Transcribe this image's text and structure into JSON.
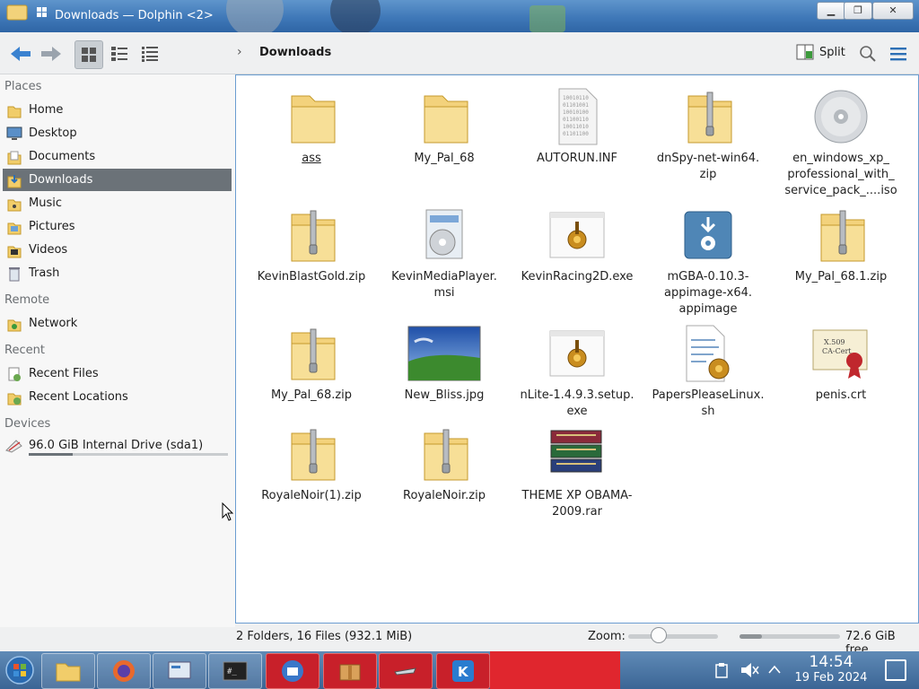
{
  "window": {
    "title": "Downloads — Dolphin <2>",
    "minimize": "▁",
    "maximize": "❐",
    "close": "✕"
  },
  "toolbar": {
    "breadcrumb": "Downloads",
    "split_label": "Split"
  },
  "sidebar": {
    "sections": {
      "places": "Places",
      "remote": "Remote",
      "recent": "Recent",
      "devices": "Devices"
    },
    "places": [
      {
        "label": "Home",
        "icon": "home-icon"
      },
      {
        "label": "Desktop",
        "icon": "desktop-icon"
      },
      {
        "label": "Documents",
        "icon": "documents-icon"
      },
      {
        "label": "Downloads",
        "icon": "downloads-icon",
        "selected": true
      },
      {
        "label": "Music",
        "icon": "music-icon"
      },
      {
        "label": "Pictures",
        "icon": "pictures-icon"
      },
      {
        "label": "Videos",
        "icon": "videos-icon"
      },
      {
        "label": "Trash",
        "icon": "trash-icon"
      }
    ],
    "remote": [
      {
        "label": "Network",
        "icon": "network-icon"
      }
    ],
    "recent": [
      {
        "label": "Recent Files",
        "icon": "recent-files-icon"
      },
      {
        "label": "Recent Locations",
        "icon": "recent-locations-icon"
      }
    ],
    "devices": [
      {
        "label": "96.0 GiB Internal Drive (sda1)",
        "icon": "drive-icon",
        "usage_fraction": 0.22
      }
    ]
  },
  "files": [
    {
      "name": "ass",
      "type": "folder"
    },
    {
      "name": "My_Pal_68",
      "type": "folder"
    },
    {
      "name": "AUTORUN.INF",
      "type": "text"
    },
    {
      "name": "dnSpy-net-win64.\nzip",
      "type": "zip"
    },
    {
      "name": "en_windows_xp_\nprofessional_with_\nservice_pack_....iso",
      "type": "disc"
    },
    {
      "name": "KevinBlastGold.zip",
      "type": "zip"
    },
    {
      "name": "KevinMediaPlayer.\nmsi",
      "type": "msi"
    },
    {
      "name": "KevinRacing2D.exe",
      "type": "exe"
    },
    {
      "name": "mGBA-0.10.3-\nappimage-x64.\nappimage",
      "type": "appimage"
    },
    {
      "name": "My_Pal_68.1.zip",
      "type": "zip"
    },
    {
      "name": "My_Pal_68.zip",
      "type": "zip"
    },
    {
      "name": "New_Bliss.jpg",
      "type": "image"
    },
    {
      "name": "nLite-1.4.9.3.setup.\nexe",
      "type": "exe"
    },
    {
      "name": "PapersPleaseLinux.\nsh",
      "type": "script"
    },
    {
      "name": "penis.crt",
      "type": "cert"
    },
    {
      "name": "RoyaleNoir(1).zip",
      "type": "zip"
    },
    {
      "name": "RoyaleNoir.zip",
      "type": "zip"
    },
    {
      "name": "THEME XP OBAMA-\n2009.rar",
      "type": "rar"
    }
  ],
  "status": {
    "summary": "2 Folders, 16 Files (932.1 MiB)",
    "zoom_label": "Zoom:",
    "zoom_level": 0.33,
    "free_space": "72.6 GiB free",
    "disk_used_fraction": 0.22
  },
  "taskbar": {
    "time": "14:54",
    "date": "19 Feb 2024"
  }
}
